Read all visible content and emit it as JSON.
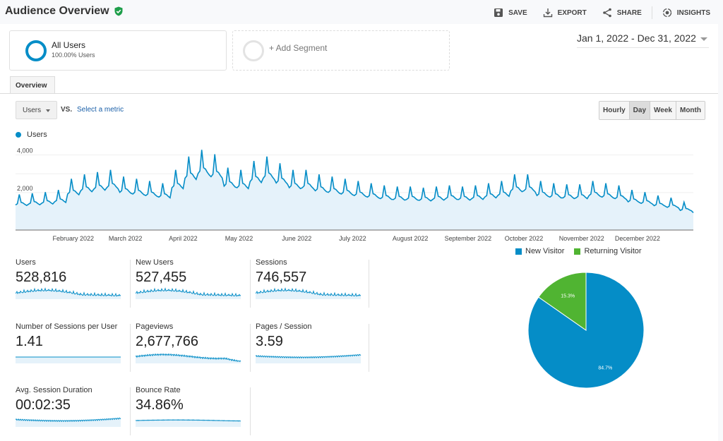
{
  "header": {
    "title": "Audience Overview",
    "actions": [
      {
        "label": "SAVE",
        "icon": "save-icon"
      },
      {
        "label": "EXPORT",
        "icon": "export-icon"
      },
      {
        "label": "SHARE",
        "icon": "share-icon"
      },
      {
        "label": "INSIGHTS",
        "icon": "insights-icon"
      }
    ]
  },
  "segments": {
    "all_users": {
      "title": "All Users",
      "subtitle": "100.00% Users"
    },
    "add_segment": "+ Add Segment"
  },
  "date_range": "Jan 1, 2022 - Dec 31, 2022",
  "tabs": [
    {
      "label": "Overview",
      "active": true
    }
  ],
  "metric_picker": {
    "selected": "Users",
    "vs_label": "VS.",
    "compare_link": "Select a metric"
  },
  "granularity": {
    "options": [
      "Hourly",
      "Day",
      "Week",
      "Month"
    ],
    "selected": "Day"
  },
  "colors": {
    "primary": "#058dc7",
    "secondary": "#50b432",
    "area_fill": "#e5f2fa"
  },
  "chart_data": [
    {
      "type": "area",
      "title": "",
      "legend": [
        "Users"
      ],
      "legend_position": "top-left",
      "ylabel": "",
      "ylim": [
        0,
        4400
      ],
      "yticks": [
        2000,
        4000
      ],
      "ytick_labels": [
        "2,000",
        "4,000"
      ],
      "xtick_labels": [
        "February 2022",
        "March 2022",
        "April 2022",
        "May 2022",
        "June 2022",
        "July 2022",
        "August 2022",
        "September 2022",
        "October 2022",
        "November 2022",
        "December 2022"
      ],
      "grid": true,
      "series": [
        {
          "name": "Users",
          "x_range": [
            "2022-01-01",
            "2022-12-31"
          ],
          "weekly_values": [
            1600,
            1650,
            1700,
            1800,
            2300,
            2500,
            2600,
            2700,
            2400,
            2300,
            2200,
            2100,
            2700,
            3300,
            3600,
            3400,
            2800,
            2700,
            3100,
            3300,
            3000,
            2700,
            2700,
            2500,
            2400,
            2300,
            2200,
            2100,
            2000,
            1950,
            1950,
            1900,
            1950,
            2000,
            1950,
            2000,
            2100,
            2200,
            2500,
            2500,
            2200,
            2100,
            2050,
            2050,
            2200,
            2100,
            2000,
            1800,
            1700,
            1550,
            1450,
            1250,
            1100,
            1000
          ]
        }
      ]
    },
    {
      "type": "pie",
      "legend": [
        "New Visitor",
        "Returning Visitor"
      ],
      "legend_position": "top",
      "categories": [
        "New Visitor",
        "Returning Visitor"
      ],
      "values": [
        84.7,
        15.3
      ],
      "data_labels": [
        "84.7%",
        "15.3%"
      ]
    }
  ],
  "kpis": [
    {
      "label": "Users",
      "value": "528,816",
      "trend": "users"
    },
    {
      "label": "New Users",
      "value": "527,455",
      "trend": "users"
    },
    {
      "label": "Sessions",
      "value": "746,557",
      "trend": "users"
    },
    {
      "label": "Number of Sessions per User",
      "value": "1.41",
      "trend": "flat"
    },
    {
      "label": "Pageviews",
      "value": "2,677,766",
      "trend": "pageviews"
    },
    {
      "label": "Pages / Session",
      "value": "3.59",
      "trend": "pps"
    },
    {
      "label": "Avg. Session Duration",
      "value": "00:02:35",
      "trend": "pps"
    },
    {
      "label": "Bounce Rate",
      "value": "34.86%",
      "trend": "bounce"
    }
  ]
}
